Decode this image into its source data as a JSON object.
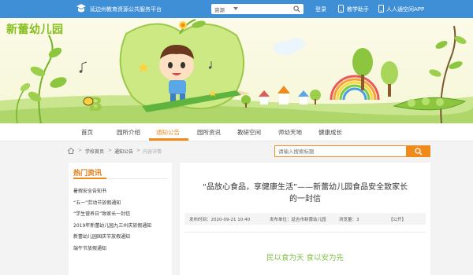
{
  "topbar": {
    "platform_name": "延边州教育资源公共服务平台",
    "search_scope": "资源",
    "login": "登录",
    "assistant": "教学助手",
    "app": "人人通空间APP"
  },
  "banner": {
    "school_name": "新蕾幼儿园"
  },
  "nav": {
    "items": [
      "首页",
      "园所介绍",
      "通知公告",
      "园所资讯",
      "教研空间",
      "师幼天地",
      "健康成长"
    ],
    "active_index": 2
  },
  "breadcrumb": {
    "items": [
      "学校首页",
      "通知公告",
      "内容详情"
    ],
    "separator": ">"
  },
  "search": {
    "placeholder": "请输入搜索标题"
  },
  "hot_news": {
    "heading": "热门资讯",
    "items": [
      "暑假安全告知书",
      "“五一”劳动节放假通知",
      "“学生营养日”致家长一封信",
      "2019年新蕾幼儿园九三州庆放假通知",
      "新蕾幼儿园国庆节放假通知",
      "端午节放假通知"
    ]
  },
  "article": {
    "title_line1": "“品放心食品，享健康生活”——新蕾幼儿园食品安全致家长",
    "title_line2": "的一封信",
    "meta": {
      "published": "发布时间：2020-09-21 10:40",
      "unit": "发布单位：延吉市新蕾幼儿园",
      "views": "浏览量：3",
      "visibility": "【公开】"
    },
    "slogan": "民以食为天 食以安为先"
  },
  "colors": {
    "topbar": "#3f8fd6",
    "accent": "#f08a1b",
    "green": "#86bf1d"
  }
}
